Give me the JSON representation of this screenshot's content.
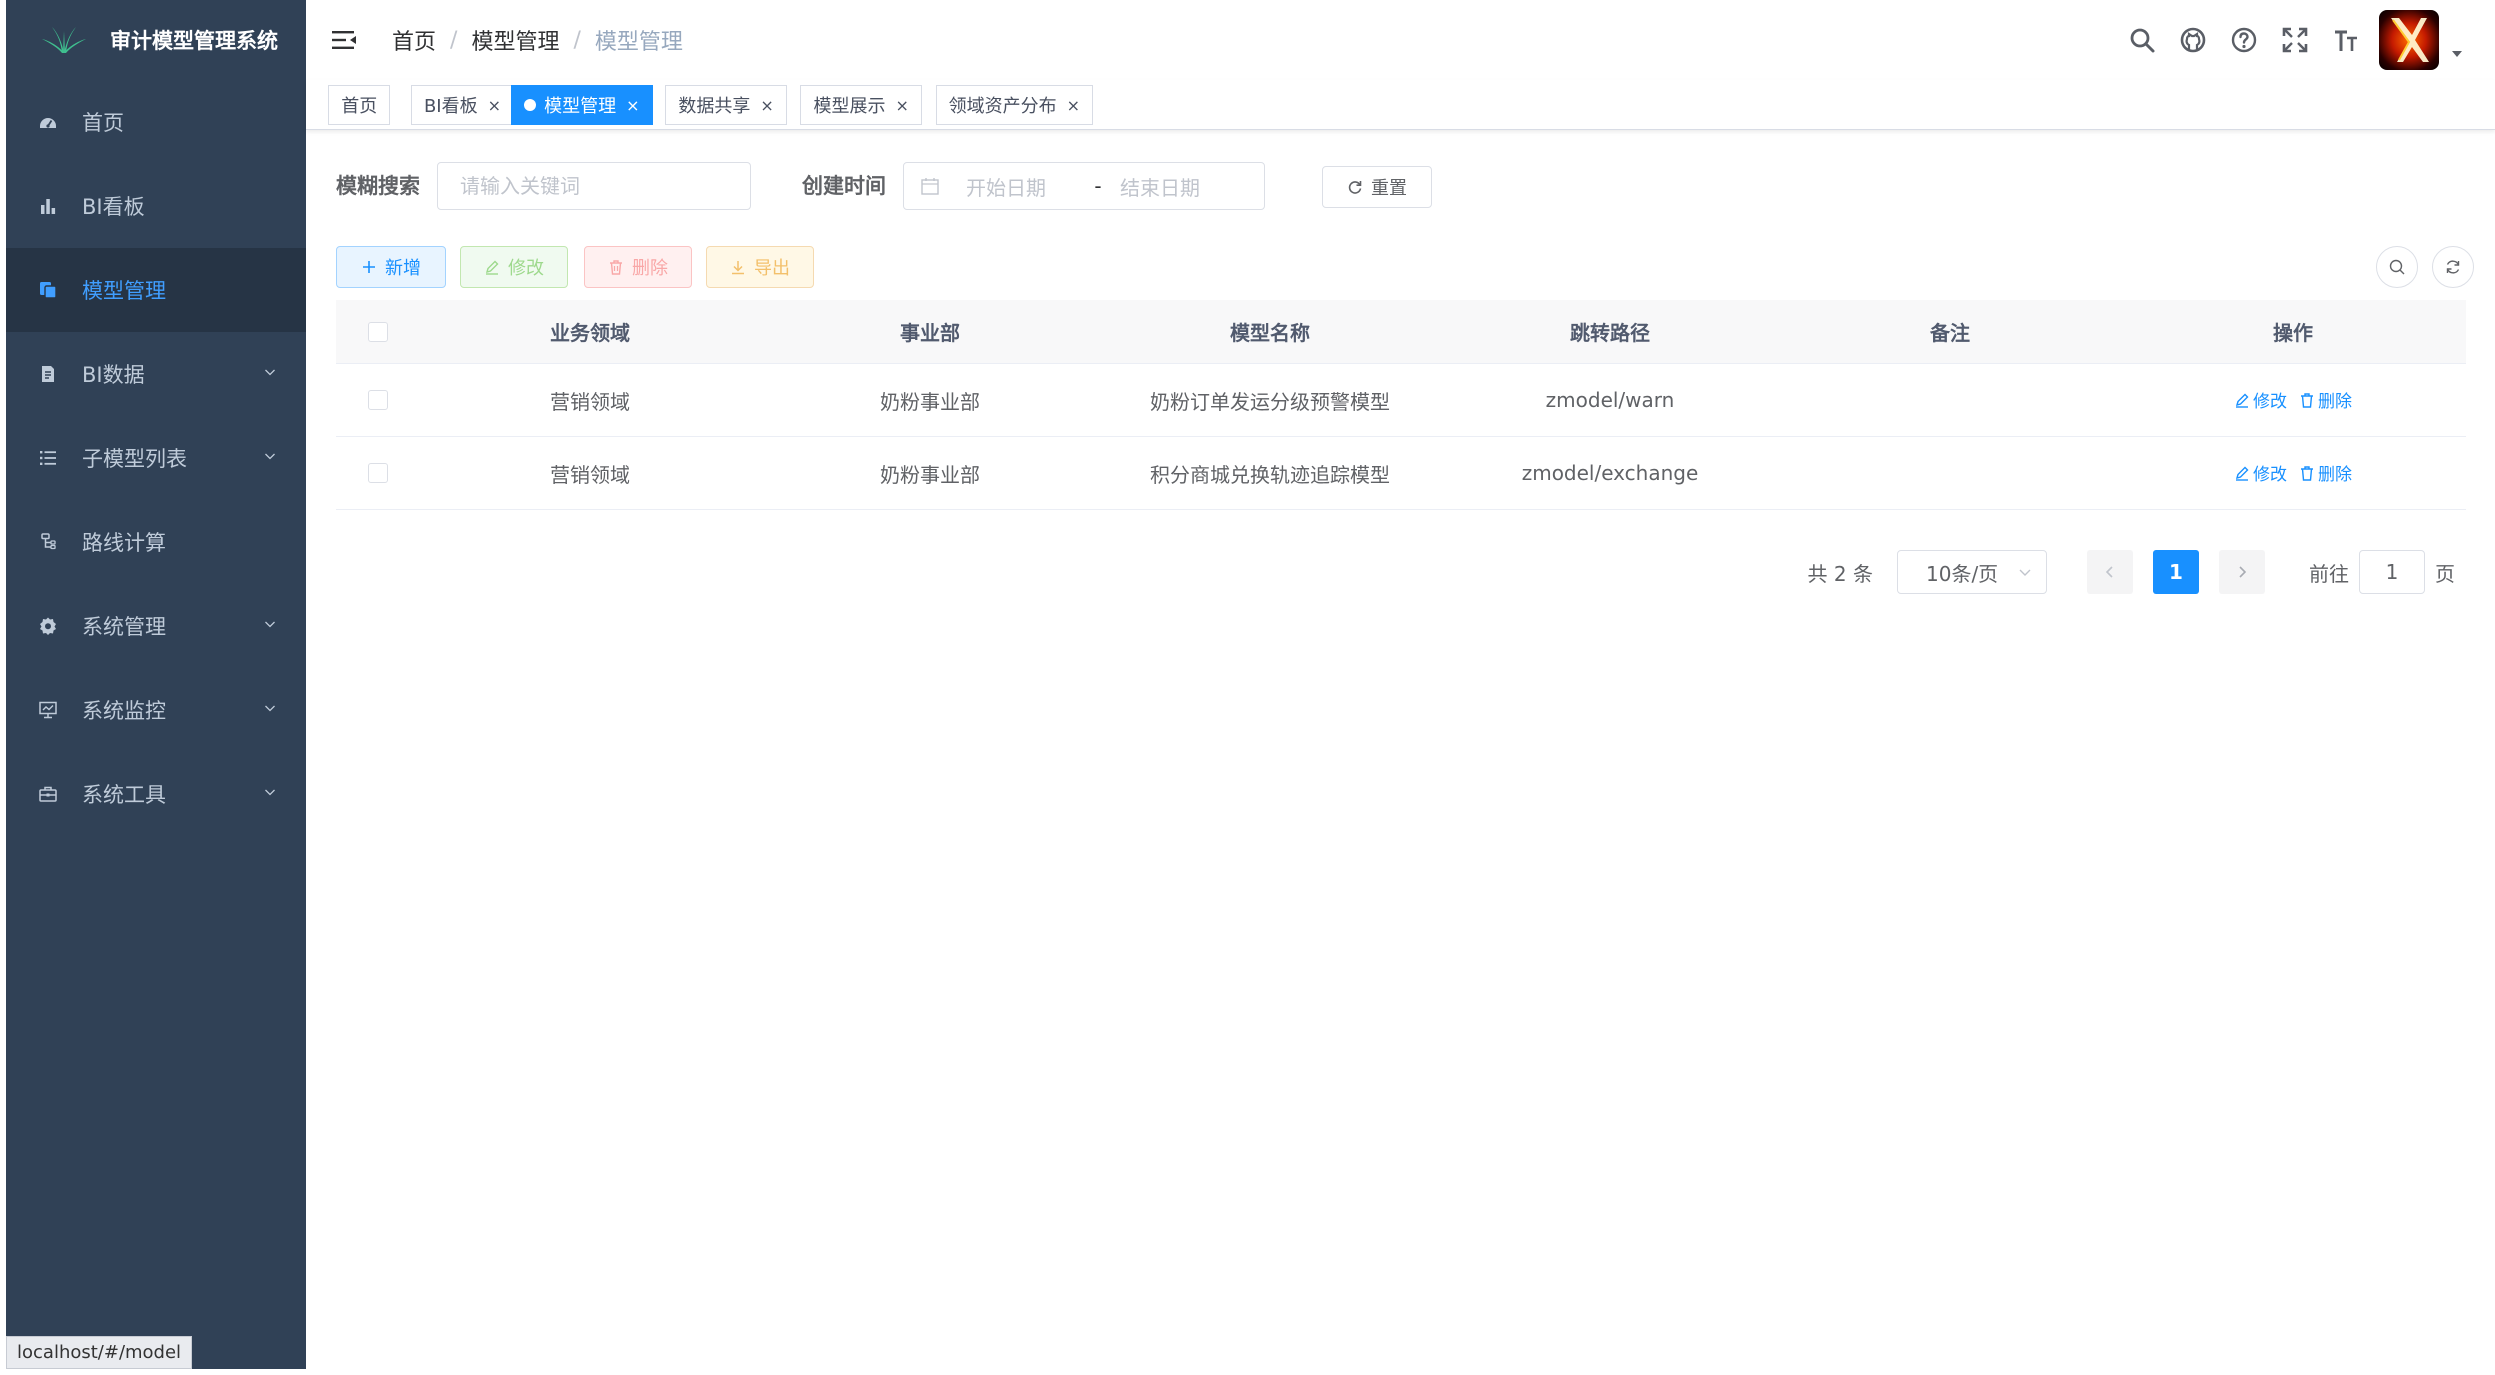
{
  "app": {
    "title": "审计模型管理系统",
    "status_url": "localhost/#/model"
  },
  "colors": {
    "sidebar_bg": "#304156",
    "sidebar_text": "#bfcbd9",
    "active": "#409eff",
    "primary": "#1890ff",
    "success": "#9ed98d",
    "danger": "#f9a7a7",
    "warning": "#f3c06b"
  },
  "sidebar": {
    "items": [
      {
        "label": "首页",
        "icon": "dashboard-icon",
        "expandable": false,
        "active": false
      },
      {
        "label": "BI看板",
        "icon": "bar-chart-icon",
        "expandable": false,
        "active": false
      },
      {
        "label": "模型管理",
        "icon": "model-icon",
        "expandable": false,
        "active": true
      },
      {
        "label": "BI数据",
        "icon": "document-icon",
        "expandable": true,
        "active": false
      },
      {
        "label": "子模型列表",
        "icon": "list-icon",
        "expandable": true,
        "active": false
      },
      {
        "label": "路线计算",
        "icon": "route-icon",
        "expandable": false,
        "active": false
      },
      {
        "label": "系统管理",
        "icon": "gear-icon",
        "expandable": true,
        "active": false
      },
      {
        "label": "系统监控",
        "icon": "monitor-icon",
        "expandable": true,
        "active": false
      },
      {
        "label": "系统工具",
        "icon": "toolbox-icon",
        "expandable": true,
        "active": false
      }
    ]
  },
  "navbar": {
    "breadcrumb": [
      "首页",
      "模型管理",
      "模型管理"
    ],
    "separator": "/",
    "tools": [
      "search-icon",
      "github-icon",
      "question-icon",
      "fullscreen-icon",
      "font-size-icon"
    ]
  },
  "tags": [
    {
      "label": "首页",
      "closable": false,
      "active": false
    },
    {
      "label": "BI看板",
      "closable": true,
      "active": false
    },
    {
      "label": "模型管理",
      "closable": true,
      "active": true
    },
    {
      "label": "数据共享",
      "closable": true,
      "active": false
    },
    {
      "label": "模型展示",
      "closable": true,
      "active": false
    },
    {
      "label": "领域资产分布",
      "closable": true,
      "active": false
    }
  ],
  "search": {
    "keyword_label": "模糊搜索",
    "keyword_placeholder": "请输入关键词",
    "keyword_value": "",
    "date_label": "创建时间",
    "start_placeholder": "开始日期",
    "end_placeholder": "结束日期",
    "range_separator": "-",
    "reset_label": "重置"
  },
  "toolbar": {
    "add_label": "新增",
    "edit_label": "修改",
    "delete_label": "删除",
    "export_label": "导出"
  },
  "table": {
    "columns": [
      "业务领域",
      "事业部",
      "模型名称",
      "跳转路径",
      "备注",
      "操作"
    ],
    "rows": [
      {
        "domain": "营销领域",
        "division": "奶粉事业部",
        "name": "奶粉订单发运分级预警模型",
        "path": "zmodel/warn",
        "remark": ""
      },
      {
        "domain": "营销领域",
        "division": "奶粉事业部",
        "name": "积分商城兑换轨迹追踪模型",
        "path": "zmodel/exchange",
        "remark": ""
      }
    ],
    "op_edit": "修改",
    "op_delete": "删除"
  },
  "pagination": {
    "total_text": "共 2 条",
    "page_size": "10条/页",
    "current_page": "1",
    "goto_prefix": "前往",
    "goto_value": "1",
    "goto_suffix": "页"
  }
}
